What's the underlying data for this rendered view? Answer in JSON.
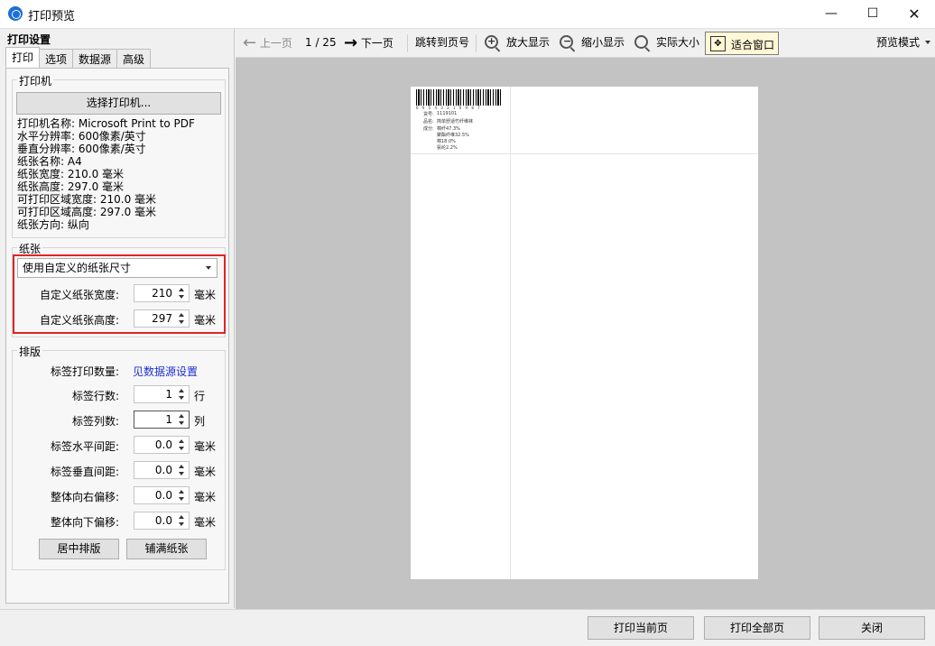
{
  "window": {
    "title": "打印预览",
    "minimize": "—",
    "maximize": "☐",
    "close": "✕"
  },
  "left_panel": {
    "header": "打印设置",
    "tabs": [
      "打印",
      "选项",
      "数据源",
      "高级"
    ],
    "printer_group": {
      "title": "打印机",
      "select_button": "选择打印机...",
      "info": [
        "打印机名称: Microsoft Print to PDF",
        "水平分辨率: 600像素/英寸",
        "垂直分辨率: 600像素/英寸",
        "纸张名称: A4",
        "纸张宽度: 210.0 毫米",
        "纸张高度: 297.0 毫米",
        "可打印区域宽度: 210.0 毫米",
        "可打印区域高度: 297.0 毫米",
        "纸张方向: 纵向"
      ]
    },
    "paper_group": {
      "title": "纸张",
      "size_select": "使用自定义的纸张尺寸",
      "width_label": "自定义纸张宽度:",
      "width_value": "210",
      "height_label": "自定义纸张高度:",
      "height_value": "297",
      "unit": "毫米"
    },
    "layout_group": {
      "title": "排版",
      "print_count_label": "标签打印数量:",
      "print_count_link": "见数据源设置",
      "rows_label": "标签行数:",
      "rows_value": "1",
      "rows_unit": "行",
      "cols_label": "标签列数:",
      "cols_value": "1",
      "cols_unit": "列",
      "hgap_label": "标签水平间距:",
      "hgap_value": "0.0",
      "vgap_label": "标签垂直间距:",
      "vgap_value": "0.0",
      "offset_right_label": "整体向右偏移:",
      "offset_right_value": "0.0",
      "offset_down_label": "整体向下偏移:",
      "offset_down_value": "0.0",
      "unit": "毫米",
      "center_button": "居中排版",
      "fill_button": "铺满纸张"
    }
  },
  "toolbar": {
    "prev": "上一页",
    "page_indicator": "1 / 25",
    "next": "下一页",
    "goto": "跳转到页号",
    "zoom_in": "放大显示",
    "zoom_out": "缩小显示",
    "actual_size": "实际大小",
    "fit_window": "适合窗口",
    "preview_mode": "预览模式"
  },
  "label_preview": {
    "barcode_digits": "6 9 5 4 3 2 1 0 9 8 7",
    "line1_key": "货号:",
    "line1_val": "1119101",
    "line2_key": "品名:",
    "line2_val": "简单舒适竹纤维袜",
    "line3_key": "成分:",
    "line3_val1": "棉纤47.3%",
    "line3_val2": "聚酯纤维32.5%",
    "line3_val3": "棉18.0%",
    "line3_val4": "氨纶2.2%"
  },
  "bottom": {
    "print_current": "打印当前页",
    "print_all": "打印全部页",
    "close": "关闭"
  }
}
